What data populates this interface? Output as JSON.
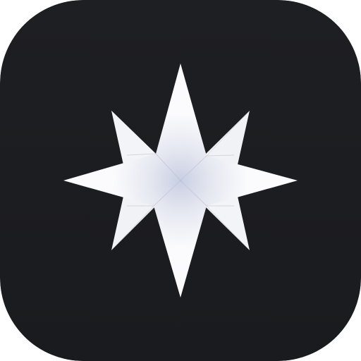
{
  "icon": {
    "name": "compass-star-app-icon",
    "glyph": "eight-point-compass-star",
    "background_color": "#1c1d20",
    "star_color": "#f4f5f8",
    "center_shade_color": "#d5d9e8"
  }
}
